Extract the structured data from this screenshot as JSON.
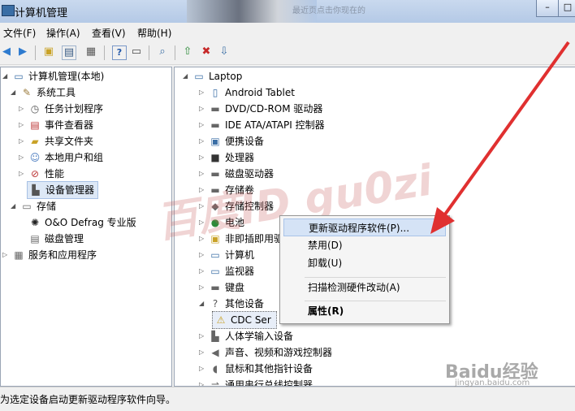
{
  "window": {
    "title": "计算机管理",
    "title_ghost_text": "最近页点击你现在的"
  },
  "menubar": {
    "file": "文件(F)",
    "action": "操作(A)",
    "view": "查看(V)",
    "help": "帮助(H)"
  },
  "left_tree": {
    "root": "计算机管理(本地)",
    "system_tools": "系统工具",
    "task_scheduler": "任务计划程序",
    "event_viewer": "事件查看器",
    "shared_folders": "共享文件夹",
    "local_users": "本地用户和组",
    "performance": "性能",
    "device_manager": "设备管理器",
    "storage": "存储",
    "defrag": "O&O Defrag 专业版",
    "disk_mgmt": "磁盘管理",
    "services": "服务和应用程序"
  },
  "device_tree": {
    "laptop": "Laptop",
    "android": "Android Tablet",
    "dvd": "DVD/CD-ROM 驱动器",
    "ide": "IDE ATA/ATAPI 控制器",
    "portable": "便携设备",
    "cpu": "处理器",
    "disk": "磁盘驱动器",
    "storage_vol": "存储卷",
    "storage_ctrl": "存储控制器",
    "battery": "电池",
    "non_pnp": "非即插即用驱",
    "computer": "计算机",
    "monitor": "监视器",
    "keyboard": "键盘",
    "other": "其他设备",
    "cdc": "CDC Ser",
    "hid": "人体学输入设备",
    "audio": "声音、视频和游戏控制器",
    "mouse": "鼠标和其他指针设备",
    "usb": "通用串行总线控制器"
  },
  "context_menu": {
    "update_driver": "更新驱动程序软件(P)...",
    "disable": "禁用(D)",
    "uninstall": "卸载(U)",
    "scan": "扫描检测硬件改动(A)",
    "properties": "属性(R)"
  },
  "status": {
    "text": "为选定设备启动更新驱动程序软件向导。"
  },
  "watermarks": {
    "overlay": "百度ID gu0zi",
    "baidu_logo": "Baidu经验",
    "baidu_url": "jingyan.baidu.com"
  },
  "colors": {
    "arrow": "#e03030",
    "selection": "#dde8f6"
  }
}
